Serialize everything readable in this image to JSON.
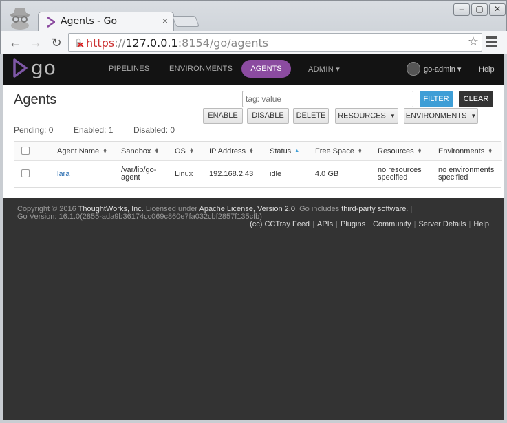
{
  "browser": {
    "tab_title": "Agents - Go",
    "tab_close": "×",
    "url_scheme": "https",
    "url_sep": "://",
    "url_host": "127.0.0.1",
    "url_rest": ":8154/go/agents",
    "window_buttons": [
      "‒",
      "▢",
      "✕"
    ]
  },
  "header": {
    "logo": "go",
    "nav": [
      "PIPELINES",
      "ENVIRONMENTS",
      "AGENTS",
      "ADMIN ▾"
    ],
    "user": "go-admin ▾",
    "separator": "|",
    "help": "Help",
    "accent": "#8b4ba0"
  },
  "page": {
    "title": "Agents",
    "search_placeholder": "tag: value",
    "filter_label": "FILTER",
    "clear_label": "CLEAR",
    "actions": {
      "enable": "ENABLE",
      "disable": "DISABLE",
      "delete": "DELETE",
      "resources": "RESOURCES",
      "environments": "ENVIRONMENTS"
    },
    "stats": {
      "pending": "Pending: 0",
      "enabled": "Enabled: 1",
      "disabled": "Disabled: 0"
    }
  },
  "table": {
    "columns": [
      "Agent Name",
      "Sandbox",
      "OS",
      "IP Address",
      "Status",
      "Free Space",
      "Resources",
      "Environments"
    ],
    "rows": [
      {
        "name": "lara",
        "sandbox_1": "/var/lib/go-",
        "sandbox_2": "agent",
        "os": "Linux",
        "ip": "192.168.2.43",
        "status": "idle",
        "free_space": "4.0 GB",
        "resources_1": "no resources",
        "resources_2": "specified",
        "environments_1": "no environments",
        "environments_2": "specified"
      }
    ]
  },
  "footer": {
    "copyright": "Copyright © 2016",
    "company": "ThoughtWorks, Inc.",
    "licensed": "Licensed under",
    "license": "Apache License, Version 2.0",
    "includes": ". Go includes",
    "third_party": "third-party software",
    "dot": ".",
    "bar": "|",
    "version": "Go Version: 16.1.0(2855-ada9b36174cc069c860e7fa032cbf2857f135cfb)",
    "links": [
      "(cc) CCTray Feed",
      "APIs",
      "Plugins",
      "Community",
      "Server Details",
      "Help"
    ]
  }
}
